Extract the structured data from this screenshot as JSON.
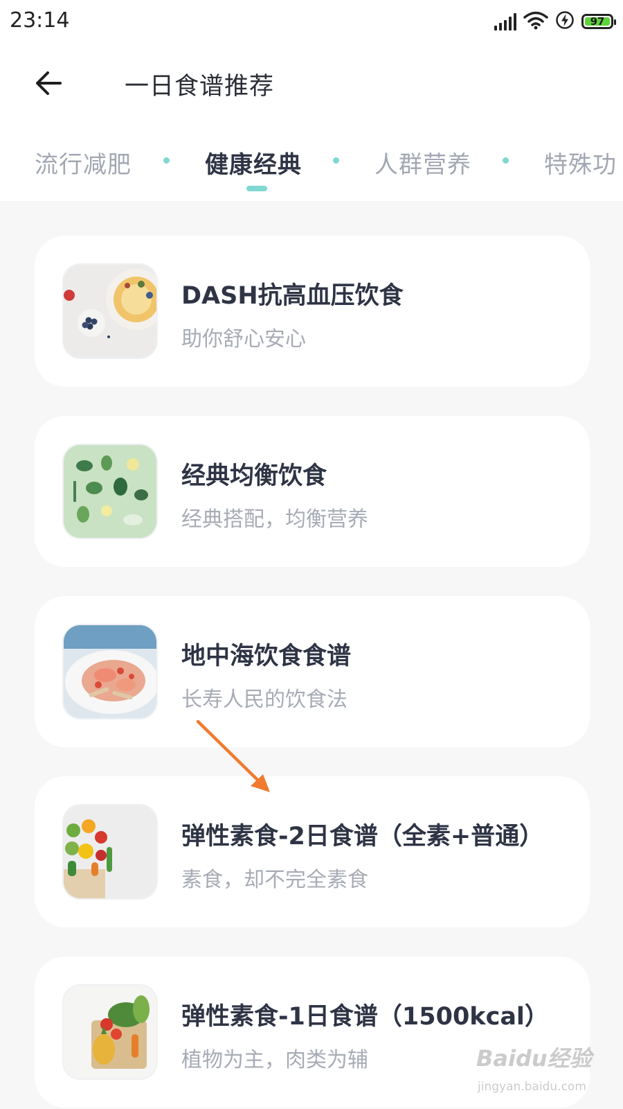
{
  "status_bar": {
    "time": "23:14",
    "battery": "97",
    "icons": [
      "signal-icon",
      "wifi-icon",
      "charging-icon",
      "battery-icon"
    ]
  },
  "header": {
    "title": "一日食谱推荐",
    "back_icon": "arrow-left-icon"
  },
  "tabs": [
    {
      "label": "流行减肥",
      "active": false
    },
    {
      "label": "健康经典",
      "active": true
    },
    {
      "label": "人群营养",
      "active": false
    },
    {
      "label": "特殊功",
      "active": false
    }
  ],
  "recipes": [
    {
      "title": "DASH抗高血压饮食",
      "subtitle": "助你舒心安心"
    },
    {
      "title": "经典均衡饮食",
      "subtitle": "经典搭配，均衡营养"
    },
    {
      "title": "地中海饮食食谱",
      "subtitle": "长寿人民的饮食法"
    },
    {
      "title": "弹性素食-2日食谱（全素+普通）",
      "subtitle": "素食，却不完全素食"
    },
    {
      "title": "弹性素食-1日食谱（1500kcal）",
      "subtitle": "植物为主，肉类为辅"
    }
  ],
  "watermark": {
    "logo": "Baidu经验",
    "url": "jingyan.baidu.com"
  },
  "colors": {
    "accent": "#7fd8d2",
    "annotation_arrow": "#f07a2f",
    "battery_fill": "#5fd33b",
    "page_background": "#f7f7f8"
  }
}
